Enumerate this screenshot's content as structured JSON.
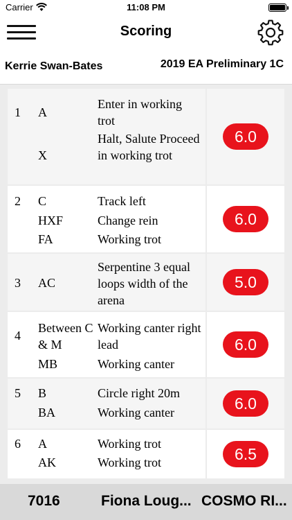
{
  "status": {
    "carrier": "Carrier",
    "time": "11:08 PM"
  },
  "nav": {
    "title": "Scoring",
    "menu_icon": "hamburger-icon",
    "settings_icon": "gear-icon"
  },
  "info": {
    "rider": "Kerrie Swan-Bates",
    "test": "2019 EA Preliminary 1C"
  },
  "movements": [
    {
      "number": "1",
      "markers": [
        "A",
        "X"
      ],
      "descriptions": [
        "Enter in working trot",
        "Halt, Salute Proceed in working trot"
      ],
      "score": "6.0"
    },
    {
      "number": "2",
      "markers": [
        "C",
        "HXF",
        "FA"
      ],
      "descriptions": [
        "Track left",
        "Change rein",
        "Working trot"
      ],
      "score": "6.0"
    },
    {
      "number": "3",
      "markers": [
        "AC"
      ],
      "descriptions": [
        "Serpentine 3 equal loops width of the arena"
      ],
      "score": "5.0"
    },
    {
      "number": "4",
      "markers": [
        "Between C & M",
        "MB"
      ],
      "descriptions": [
        "Working canter right lead",
        "Working canter"
      ],
      "score": "6.0"
    },
    {
      "number": "5",
      "markers": [
        "B",
        "BA"
      ],
      "descriptions": [
        "Circle right 20m",
        "Working canter"
      ],
      "score": "6.0"
    },
    {
      "number": "6",
      "markers": [
        "A",
        "AK"
      ],
      "descriptions": [
        "Working trot",
        "Working trot"
      ],
      "score": "6.5"
    }
  ],
  "footer": {
    "competitor_number": "7016",
    "judge": "Fiona Loug...",
    "horse": "COSMO RI..."
  },
  "colors": {
    "score_pill": "#e8131c",
    "footer_bg": "#d9d9d9"
  }
}
